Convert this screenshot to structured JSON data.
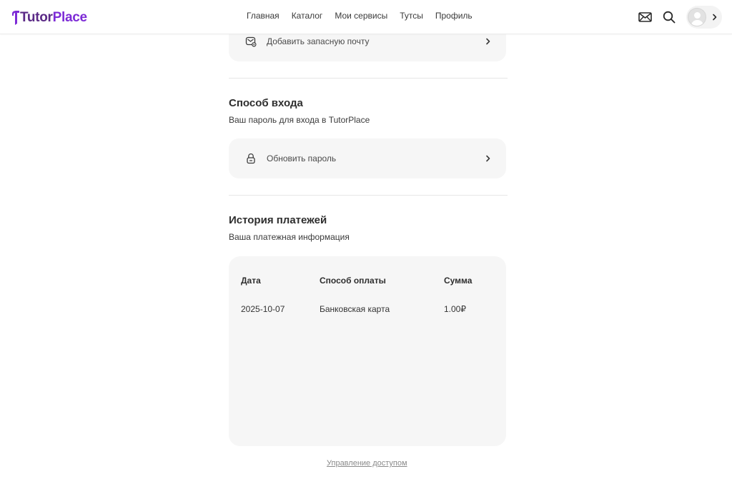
{
  "header": {
    "logo": {
      "part1": "Tutor",
      "part2": "Place"
    },
    "nav": [
      "Главная",
      "Каталог",
      "Мои сервисы",
      "Тутсы",
      "Профиль"
    ],
    "icons": {
      "mail": "mail-icon",
      "search": "search-icon",
      "avatar": "avatar",
      "chevron": "chevron-right-icon"
    }
  },
  "backup_email": {
    "label": "Добавить запасную почту",
    "icon": "mail-settings-icon"
  },
  "login_method": {
    "title": "Способ входа",
    "subtitle": "Ваш пароль для входа в TutorPlace",
    "row_label": "Обновить пароль",
    "icon": "lock-icon"
  },
  "payments": {
    "title": "История платежей",
    "subtitle": "Ваша платежная информация",
    "columns": [
      "Дата",
      "Способ оплаты",
      "Сумма"
    ],
    "rows": [
      {
        "date": "2025-10-07",
        "method": "Банковская карта",
        "amount": "1.00₽"
      }
    ]
  },
  "footer": {
    "link": "Управление доступом"
  },
  "colors": {
    "brand_dark": "#5b2a86",
    "brand_purple": "#7d2bd6",
    "card_bg": "#f6f6f6"
  }
}
